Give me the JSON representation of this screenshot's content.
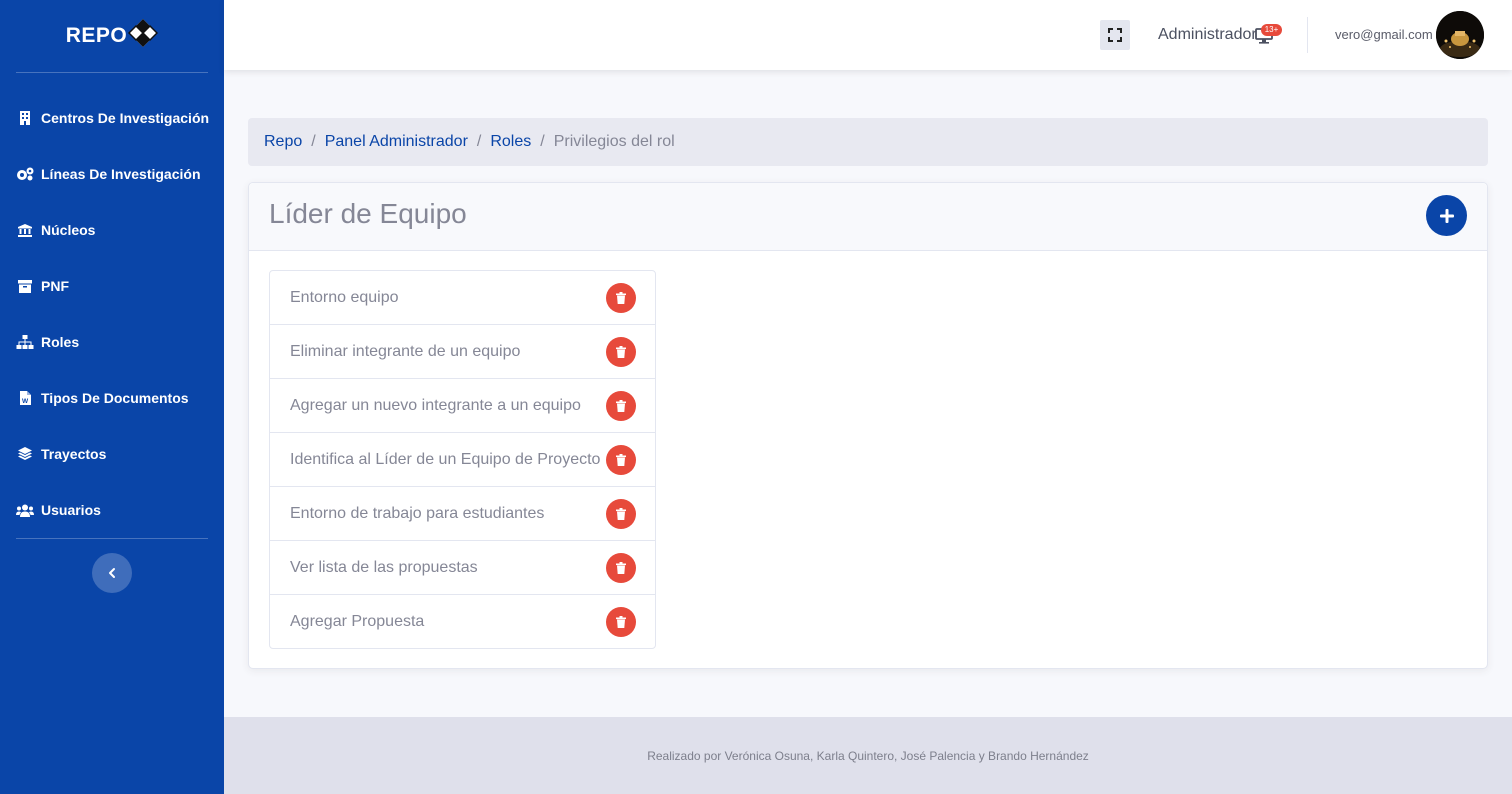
{
  "brand": {
    "name": "REPO"
  },
  "sidebar": {
    "items": [
      {
        "label": "Centros De Investigación",
        "icon": "building-icon"
      },
      {
        "label": "Líneas De Investigación",
        "icon": "cogs-icon"
      },
      {
        "label": "Núcleos",
        "icon": "university-icon"
      },
      {
        "label": "PNF",
        "icon": "archive-icon"
      },
      {
        "label": "Roles",
        "icon": "sitemap-icon"
      },
      {
        "label": "Tipos De Documentos",
        "icon": "file-word-icon"
      },
      {
        "label": "Trayectos",
        "icon": "layer-group-icon"
      },
      {
        "label": "Usuarios",
        "icon": "users-icon"
      }
    ],
    "collapse_icon": "chevron-left-icon"
  },
  "topbar": {
    "fullscreen_icon": "expand-icon",
    "role_label": "Administrador",
    "notifications_badge": "13+",
    "notifications_icon": "monitor-icon",
    "user_email": "vero@gmail.com"
  },
  "breadcrumb": {
    "items": [
      "Repo",
      "Panel Administrador",
      "Roles"
    ],
    "current": "Privilegios del rol",
    "separator": "/"
  },
  "card": {
    "title": "Líder de Equipo",
    "add_icon": "plus-icon",
    "privileges": [
      "Entorno equipo",
      "Eliminar integrante de un equipo",
      "Agregar un nuevo integrante a un equipo",
      "Identifica al Líder de un Equipo de Proyecto",
      "Entorno de trabajo para estudiantes",
      "Ver lista de las propuestas",
      "Agregar Propuesta"
    ],
    "delete_icon": "trash-icon"
  },
  "footer": {
    "text": "Realizado por Verónica Osuna, Karla Quintero, José Palencia y Brando Hernández"
  },
  "colors": {
    "primary": "#0a45a8",
    "danger": "#e74a3b",
    "muted_text": "#858796"
  }
}
